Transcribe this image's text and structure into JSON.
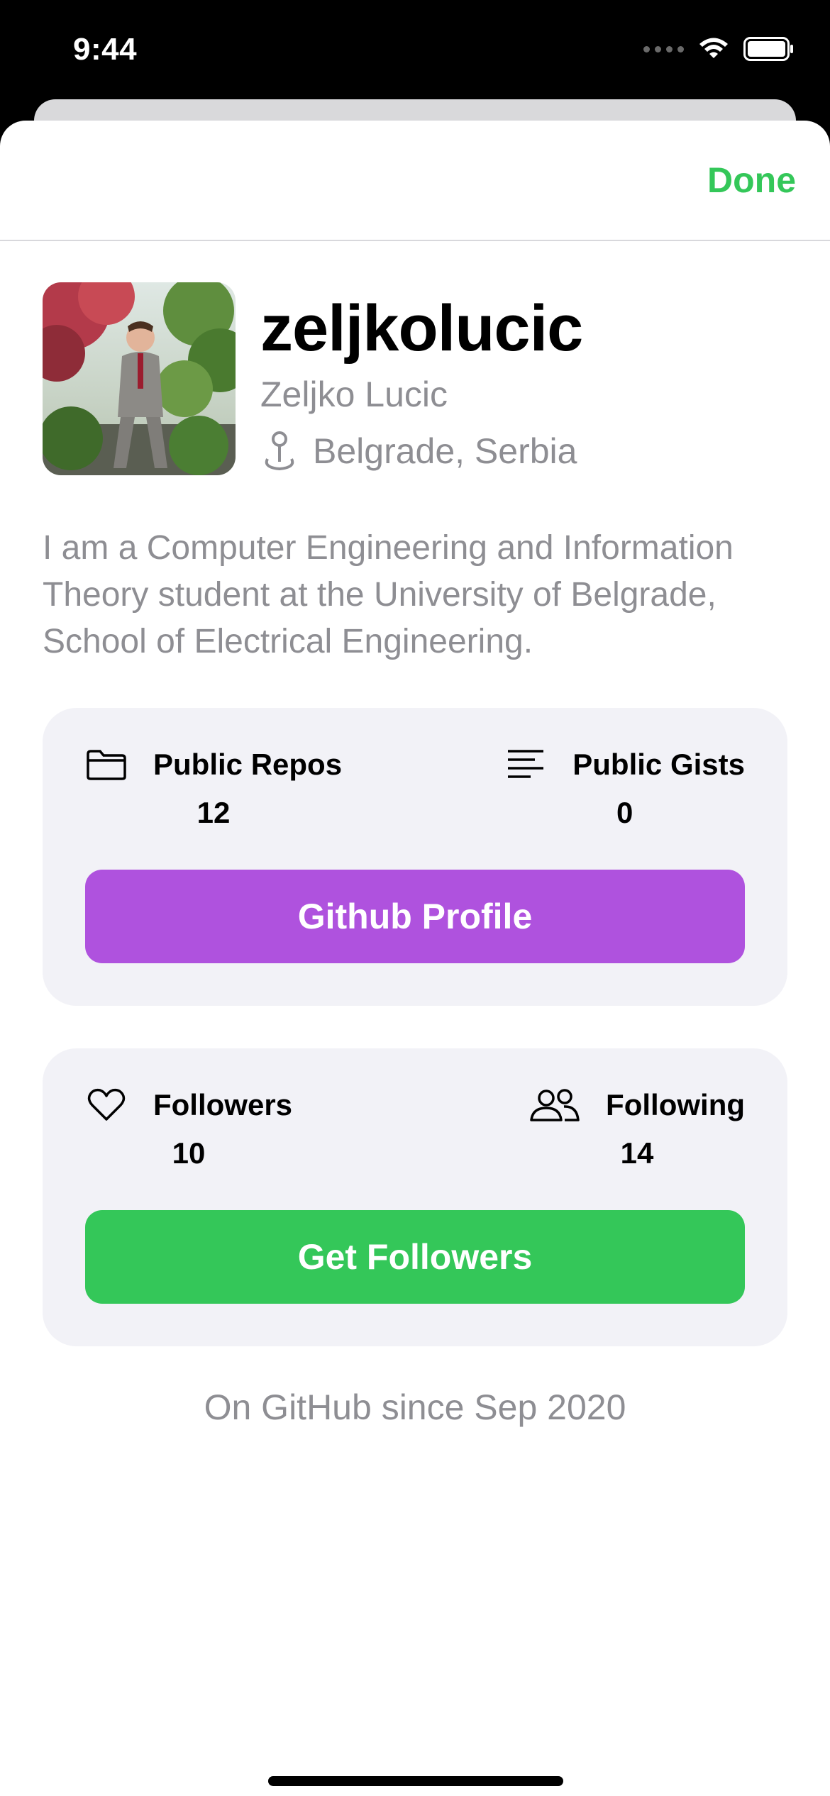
{
  "status_bar": {
    "time": "9:44"
  },
  "navbar": {
    "done_label": "Done",
    "accent_color": "#34c759"
  },
  "profile": {
    "username": "zeljkolucic",
    "full_name": "Zeljko Lucic",
    "location": "Belgrade, Serbia",
    "bio": "I am a Computer Engineering and Information Theory student at the University of Belgrade, School of Electrical Engineering."
  },
  "repo_card": {
    "left_stat": {
      "label": "Public Repos",
      "value": "12",
      "icon": "folder-icon"
    },
    "right_stat": {
      "label": "Public Gists",
      "value": "0",
      "icon": "text-lines-icon"
    },
    "button_label": "Github Profile",
    "button_color": "#af52de"
  },
  "follow_card": {
    "left_stat": {
      "label": "Followers",
      "value": "10",
      "icon": "heart-icon"
    },
    "right_stat": {
      "label": "Following",
      "value": "14",
      "icon": "people-icon"
    },
    "button_label": "Get Followers",
    "button_color": "#34c759"
  },
  "footer": {
    "member_since": "On GitHub since Sep 2020"
  }
}
